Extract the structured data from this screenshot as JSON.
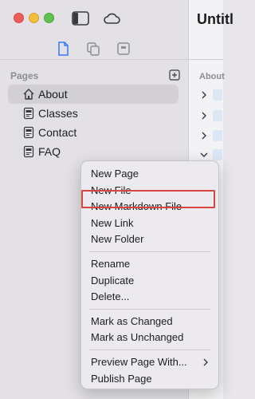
{
  "sidebar": {
    "section_title": "Pages",
    "items": [
      {
        "label": "About",
        "selected": true,
        "icon": "house-icon"
      },
      {
        "label": "Classes",
        "selected": false,
        "icon": "html-page-icon"
      },
      {
        "label": "Contact",
        "selected": false,
        "icon": "html-page-icon"
      },
      {
        "label": "FAQ",
        "selected": false,
        "icon": "html-page-icon"
      }
    ]
  },
  "editor": {
    "title": "Untitl",
    "section_label": "About"
  },
  "context_menu": {
    "group1": [
      "New Page",
      "New File",
      "New Markdown File",
      "New Link",
      "New Folder"
    ],
    "group2": [
      "Rename",
      "Duplicate",
      "Delete..."
    ],
    "group3": [
      "Mark as Changed",
      "Mark as Unchanged"
    ],
    "group4": [
      "Preview Page With...",
      "Publish Page"
    ],
    "highlighted_item": "New Link"
  },
  "colors": {
    "close": "#ee5e57",
    "minimize": "#f5bd3c",
    "maximize": "#5fc24f",
    "accent": "#3478f6",
    "highlight": "#d64541"
  }
}
